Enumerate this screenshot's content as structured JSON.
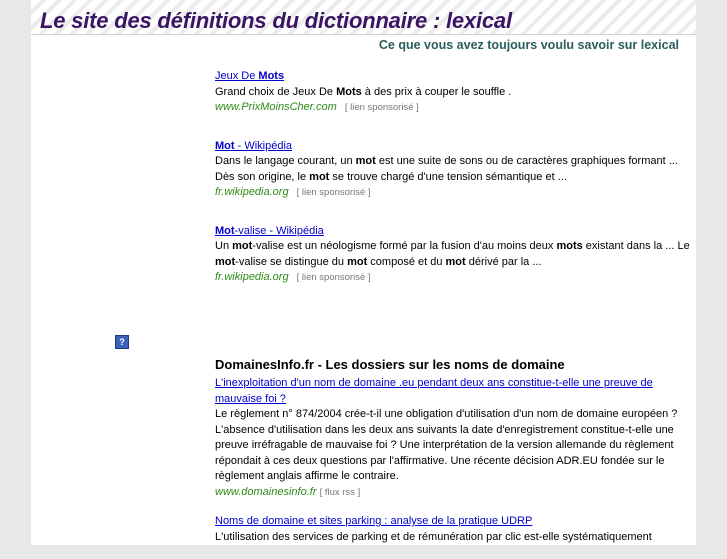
{
  "header": {
    "title": "Le site des définitions du dictionnaire : lexical",
    "subtitle": "Ce que vous avez toujours voulu savoir sur lexical"
  },
  "ads": [
    {
      "title_pre": "Jeux De ",
      "title_bold": "Mots",
      "title_post": "",
      "desc_html": "Grand choix de Jeux De <b>Mots</b> à des prix à couper le souffle .",
      "url": "www.PrixMoinsCher.com",
      "sponsor": "[ lien sponsorisé ]"
    },
    {
      "title_pre": "",
      "title_bold": "Mot",
      "title_post": " - Wikipédia",
      "desc_html": "Dans le langage courant, un <b>mot</b> est une suite de sons ou de caractères graphiques formant ... Dès son origine, le <b>mot</b> se trouve chargé d'une tension sémantique et ...",
      "url": "fr.wikipedia.org",
      "sponsor": "[ lien sponsorisé ]"
    },
    {
      "title_pre": "",
      "title_bold": "Mot",
      "title_post": "-valise - Wikipédia",
      "desc_html": "Un <b>mot</b>-valise est un néologisme formé par la fusion d'au moins deux <b>mots</b> existant dans la ... Le <b>mot</b>-valise se distingue du <b>mot</b> composé et du <b>mot</b> dérivé par la ...",
      "url": "fr.wikipedia.org",
      "sponsor": "[ lien sponsorisé ]"
    }
  ],
  "help_icon": {
    "glyph": "?"
  },
  "articles_section": {
    "title": "DomainesInfo.fr - Les dossiers sur les noms de domaine",
    "items": [
      {
        "title": "L'inexploitation d'un nom de domaine .eu pendant deux ans constitue-t-elle une preuve de mauvaise foi ?",
        "desc": "Le règlement n° 874/2004 crée-t-il une obligation d'utilisation d'un nom de domaine européen ? L'absence d'utilisation dans les deux ans suivants la date d'enregistrement constitue-t-elle une preuve irréfragable de mauvaise foi ? Une interprétation de la version allemande du règlement répondait à ces deux questions par l'affirmative. Une récente décision ADR.EU fondée sur le règlement anglais affirme le contraire.",
        "url": "www.domainesinfo.fr",
        "feed": "[ flux rss ]"
      },
      {
        "title": "Noms de domaine et sites parking : analyse de la pratique UDRP",
        "desc": "L'utilisation des services de parking et de rémunération par clic est-elle systématiquement",
        "url": "",
        "feed": ""
      }
    ]
  }
}
